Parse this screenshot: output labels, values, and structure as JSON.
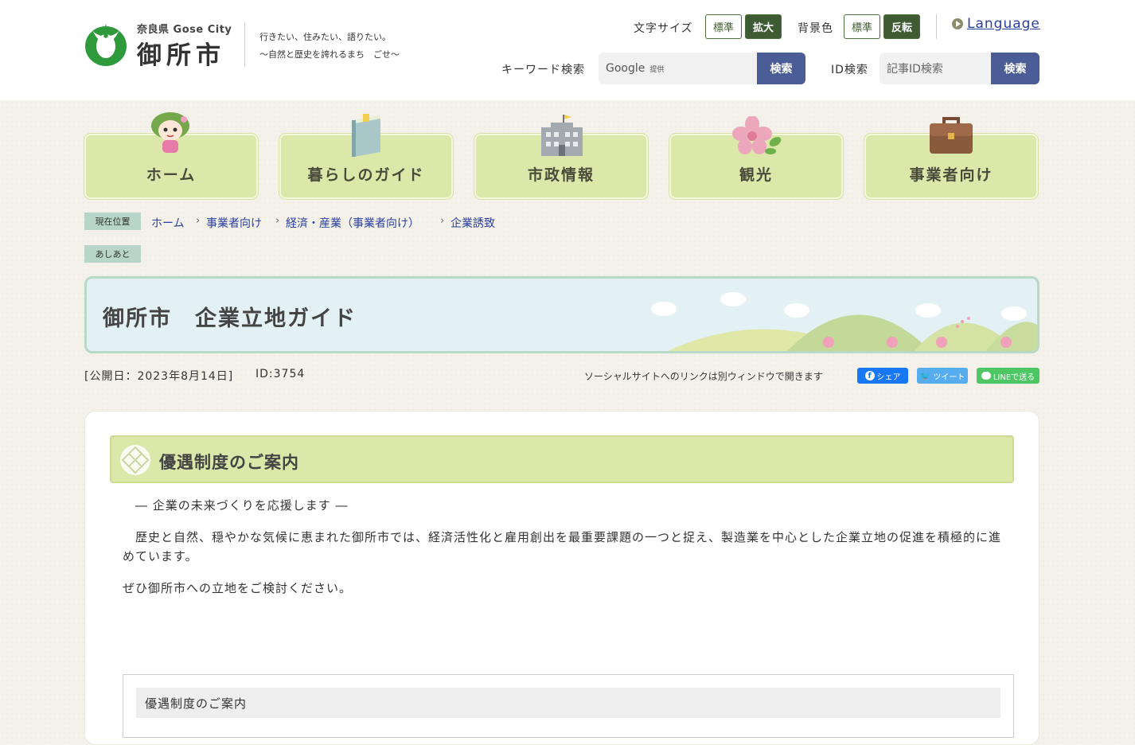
{
  "header": {
    "logo_pref": "奈良県 Gose City",
    "logo_city": "御所市",
    "slogan_1": "行きたい、住みたい、語りたい。",
    "slogan_2": "～自然と歴史を誇れるまち　ごせ～",
    "font_size_label": "文字サイズ",
    "font_size_standard": "標準",
    "font_size_large": "拡大",
    "bg_color_label": "背景色",
    "bg_standard": "標準",
    "bg_invert": "反転",
    "language_link": "Language",
    "keyword_search_label": "キーワード検索",
    "google_label": "Google",
    "google_provided": "提供",
    "keyword_search_button": "検索",
    "id_search_label": "ID検索",
    "id_search_placeholder": "記事ID検索",
    "id_search_button": "検索"
  },
  "nav": {
    "home": "ホーム",
    "living_guide": "暮らしのガイド",
    "city_admin": "市政情報",
    "tourism": "観光",
    "business": "事業者向け"
  },
  "breadcrumb": {
    "current_location_label": "現在位置",
    "items": [
      "ホーム",
      "事業者向け",
      "経済・産業（事業者向け）",
      "企業誘致"
    ],
    "footprints_label": "あしあと"
  },
  "page": {
    "title": "御所市　企業立地ガイド",
    "published": "[公開日：2023年8月14日]",
    "id_label": "ID:3754",
    "social_note": "ソーシャルサイトへのリンクは別ウィンドウで開きます",
    "share_facebook": "シェア",
    "share_twitter": "ツイート",
    "share_line": "LINEで送る"
  },
  "content": {
    "heading": "優遇制度のご案内",
    "lead": "― 企業の未来づくりを応援します ―",
    "para_1": "　歴史と自然、穏やかな気候に恵まれた御所市では、経済活性化と雇用創出を最重要課題の一つと捉え、製造業を中心とした企業立地の促進を積極的に進めています。",
    "para_2": "ぜひ御所市への立地をご検討ください。",
    "subbox_heading": "優遇制度のご案内"
  },
  "colors": {
    "accent_green": "#3e5b33",
    "nav_green": "#dce8aa",
    "search_button": "#4a5d96",
    "facebook": "#1877f2",
    "twitter": "#55acee",
    "line": "#4cc764"
  }
}
